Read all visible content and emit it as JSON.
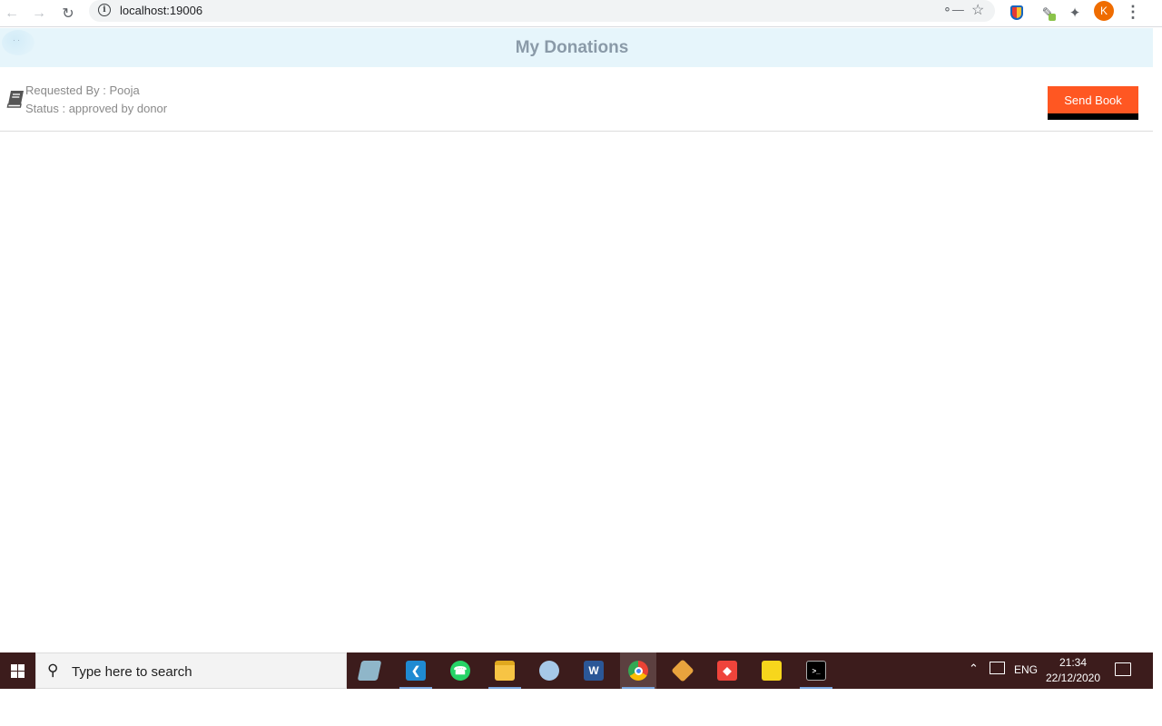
{
  "browser": {
    "url": "localhost:19006",
    "profile_initial": "K",
    "icons": {
      "back": "arrow-left-icon",
      "forward": "arrow-right-icon",
      "reload": "reload-icon",
      "site_info": "info-icon",
      "password_key": "key-icon",
      "bookmark": "star-icon",
      "extensions": "puzzle-icon",
      "menu": "more-vert-icon"
    }
  },
  "app": {
    "title": "My Donations",
    "header_bg": "#e6f5fb",
    "title_color": "#8a9aa8"
  },
  "donations": [
    {
      "requested_by": "Requested By : Pooja",
      "status": "Status : approved by donor",
      "action_label": "Send Book",
      "action_color": "#ff5722",
      "icon": "book-icon"
    }
  ],
  "taskbar": {
    "search_placeholder": "Type here to search",
    "language": "ENG",
    "time": "21:34",
    "date": "22/12/2020",
    "apps": [
      "note-app-icon",
      "vscode-icon",
      "whatsapp-icon",
      "file-explorer-icon",
      "paint-icon",
      "word-icon",
      "chrome-icon",
      "git-icon",
      "anydesk-icon",
      "sticky-notes-icon",
      "terminal-icon"
    ]
  }
}
